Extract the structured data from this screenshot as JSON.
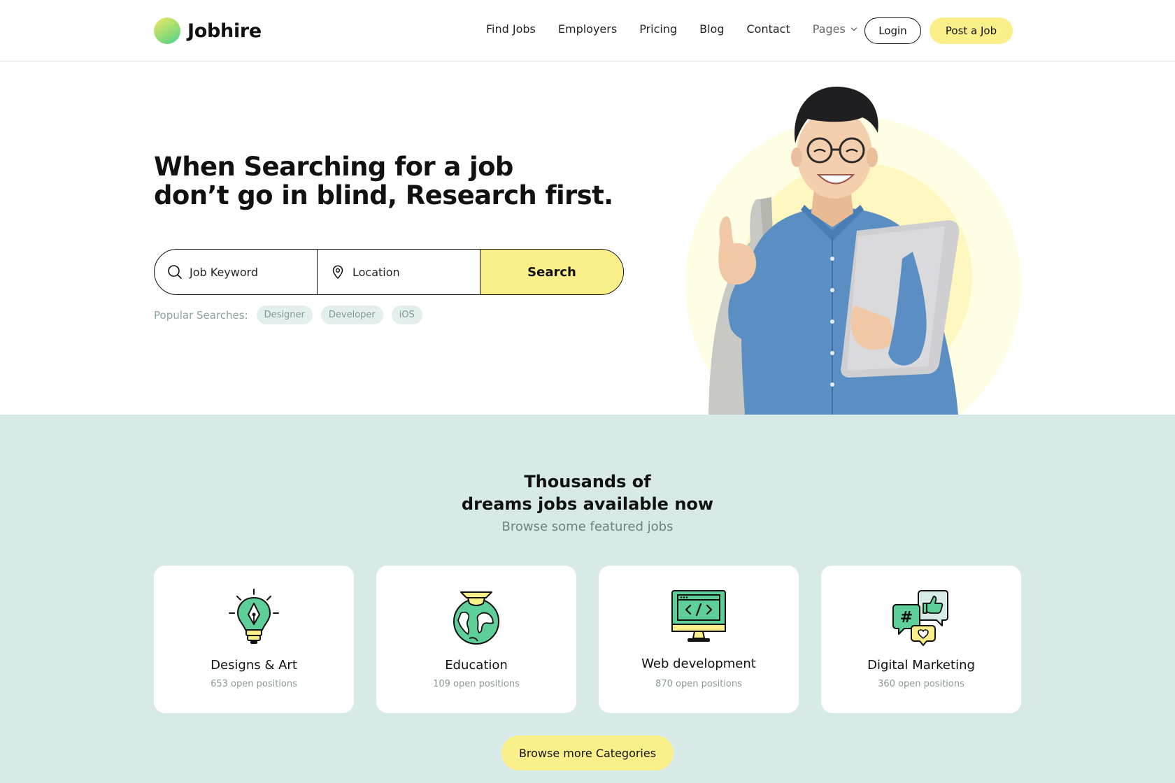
{
  "brand": {
    "name": "Jobhire"
  },
  "nav": {
    "items": [
      "Find Jobs",
      "Employers",
      "Pricing",
      "Blog",
      "Contact"
    ],
    "pages_label": "Pages",
    "login_label": "Login",
    "post_job_label": "Post a Job"
  },
  "hero": {
    "title_line1": "When Searching for a job",
    "title_line2": "don’t go in blind, Research first.",
    "keyword_placeholder": "Job Keyword",
    "location_placeholder": "Location",
    "search_label": "Search",
    "popular_label": "Popular Searches:",
    "popular_tags": [
      "Designer",
      "Developer",
      "iOS"
    ]
  },
  "featured": {
    "title_line1": "Thousands of",
    "title_line2": "dreams jobs available now",
    "subtitle": "Browse some featured jobs",
    "categories": [
      {
        "name": "Designs & Art",
        "count": "653 open positions",
        "icon": "pen-bulb-icon"
      },
      {
        "name": "Education",
        "count": "109 open positions",
        "icon": "globe-graduation-icon"
      },
      {
        "name": "Web development",
        "count": "870 open positions",
        "icon": "monitor-code-icon"
      },
      {
        "name": "Digital Marketing",
        "count": "360 open positions",
        "icon": "social-chat-icon"
      }
    ],
    "browse_label": "Browse more Categories"
  },
  "colors": {
    "accent_yellow": "#fbef8a",
    "section_bg": "#d8eae8",
    "icon_green": "#5fcf9a"
  }
}
